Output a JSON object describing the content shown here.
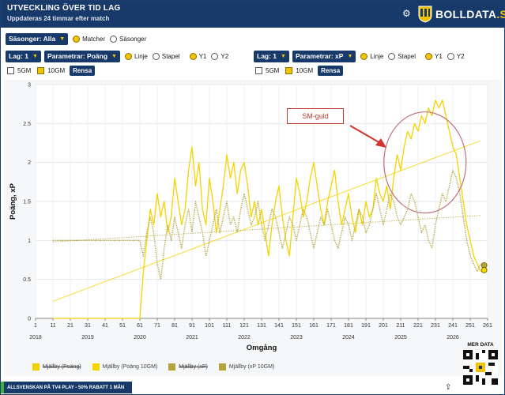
{
  "header": {
    "title": "UTVECKLING ÖVER TID LAG",
    "subtitle": "Uppdateras 24 timmar efter match",
    "logo_text": "BOLLDATA",
    "logo_suffix": ".SE"
  },
  "controls": {
    "seasons_select": "Säsonger: Alla",
    "view_options": [
      "Matcher",
      "Säsonger"
    ],
    "left": {
      "team_select": "Lag: 1",
      "param_select": "Parametrar: Poäng",
      "chart_types": [
        "Linje",
        "Stapel"
      ],
      "axes": [
        "Y1",
        "Y2"
      ],
      "smoothing": [
        "5GM",
        "10GM"
      ],
      "reset_label": "Rensa"
    },
    "right": {
      "team_select": "Lag: 1",
      "param_select": "Parametrar: xP",
      "chart_types": [
        "Linje",
        "Stapel"
      ],
      "axes": [
        "Y1",
        "Y2"
      ],
      "smoothing": [
        "5GM",
        "10GM"
      ],
      "reset_label": "Rensa"
    }
  },
  "annotation": "SM-guld",
  "legend": [
    {
      "label": "Mjällby (Poäng)",
      "color": "#f2d100",
      "enabled": false
    },
    {
      "label": "Mjällby (Poäng 10GM)",
      "color": "#f5d400",
      "enabled": true
    },
    {
      "label": "Mjällby (xP)",
      "color": "#b5a43c",
      "enabled": false
    },
    {
      "label": "Mjällby (xP 10GM)",
      "color": "#b5a43c",
      "enabled": true
    }
  ],
  "footer": {
    "banner": "ALLSVENSKAN PÅ TV4 PLAY - 50% RABATT 1 MÅN",
    "qr_label": "MER DATA"
  },
  "chart_data": {
    "type": "line",
    "xlabel": "Omgång",
    "ylabel": "Poäng, xP",
    "xlim": [
      1,
      261
    ],
    "ylim": [
      0,
      3
    ],
    "x_ticks": [
      1,
      11,
      21,
      31,
      41,
      51,
      61,
      71,
      81,
      91,
      101,
      111,
      121,
      131,
      141,
      151,
      161,
      171,
      181,
      191,
      201,
      211,
      221,
      231,
      241,
      251,
      261
    ],
    "y_ticks": [
      0,
      0.5,
      1,
      1.5,
      2,
      2.5,
      3
    ],
    "season_labels": [
      {
        "label": "2018",
        "x": 1
      },
      {
        "label": "2019",
        "x": 31
      },
      {
        "label": "2020",
        "x": 61
      },
      {
        "label": "2021",
        "x": 91
      },
      {
        "label": "2022",
        "x": 121
      },
      {
        "label": "2023",
        "x": 151
      },
      {
        "label": "2024",
        "x": 181
      },
      {
        "label": "2025",
        "x": 211
      },
      {
        "label": "2026",
        "x": 241
      }
    ],
    "series": [
      {
        "name": "Mjällby (Poäng 10GM)",
        "color": "#f5d400",
        "style": "solid",
        "points": [
          [
            11,
            0
          ],
          [
            61,
            0
          ],
          [
            62,
            0.3
          ],
          [
            63,
            0.6
          ],
          [
            65,
            1.0
          ],
          [
            67,
            1.4
          ],
          [
            69,
            1.2
          ],
          [
            71,
            1.6
          ],
          [
            73,
            1.3
          ],
          [
            75,
            1.5
          ],
          [
            77,
            1.1
          ],
          [
            79,
            1.3
          ],
          [
            81,
            1.8
          ],
          [
            83,
            1.5
          ],
          [
            85,
            1.2
          ],
          [
            87,
            1.4
          ],
          [
            89,
            1.9
          ],
          [
            91,
            2.2
          ],
          [
            93,
            1.7
          ],
          [
            95,
            2.0
          ],
          [
            97,
            1.4
          ],
          [
            99,
            1.2
          ],
          [
            101,
            1.8
          ],
          [
            103,
            1.5
          ],
          [
            105,
            1.1
          ],
          [
            107,
            1.4
          ],
          [
            109,
            1.7
          ],
          [
            111,
            2.1
          ],
          [
            113,
            1.8
          ],
          [
            115,
            2.0
          ],
          [
            117,
            1.6
          ],
          [
            119,
            1.9
          ],
          [
            121,
            2.0
          ],
          [
            123,
            1.7
          ],
          [
            125,
            1.3
          ],
          [
            127,
            1.5
          ],
          [
            129,
            1.2
          ],
          [
            131,
            1.4
          ],
          [
            133,
            1.1
          ],
          [
            135,
            0.8
          ],
          [
            137,
            1.2
          ],
          [
            139,
            1.5
          ],
          [
            141,
            1.7
          ],
          [
            143,
            1.3
          ],
          [
            145,
            1.0
          ],
          [
            147,
            0.8
          ],
          [
            149,
            1.3
          ],
          [
            151,
            1.8
          ],
          [
            153,
            1.6
          ],
          [
            155,
            1.3
          ],
          [
            157,
            1.5
          ],
          [
            159,
            1.8
          ],
          [
            161,
            2.0
          ],
          [
            163,
            1.7
          ],
          [
            165,
            1.4
          ],
          [
            167,
            1.2
          ],
          [
            169,
            1.5
          ],
          [
            171,
            1.7
          ],
          [
            173,
            1.9
          ],
          [
            175,
            1.5
          ],
          [
            177,
            1.2
          ],
          [
            179,
            1.4
          ],
          [
            181,
            1.6
          ],
          [
            183,
            1.3
          ],
          [
            185,
            1.1
          ],
          [
            187,
            1.4
          ],
          [
            189,
            1.2
          ],
          [
            191,
            1.5
          ],
          [
            193,
            1.3
          ],
          [
            195,
            1.4
          ],
          [
            197,
            1.8
          ],
          [
            199,
            1.6
          ],
          [
            201,
            1.5
          ],
          [
            203,
            1.7
          ],
          [
            205,
            1.4
          ],
          [
            207,
            1.8
          ],
          [
            209,
            2.1
          ],
          [
            211,
            1.9
          ],
          [
            213,
            2.2
          ],
          [
            215,
            2.4
          ],
          [
            217,
            2.3
          ],
          [
            219,
            2.5
          ],
          [
            221,
            2.4
          ],
          [
            223,
            2.6
          ],
          [
            225,
            2.5
          ],
          [
            227,
            2.7
          ],
          [
            229,
            2.6
          ],
          [
            231,
            2.8
          ],
          [
            233,
            2.7
          ],
          [
            235,
            2.8
          ],
          [
            237,
            2.6
          ],
          [
            239,
            2.4
          ],
          [
            241,
            2.2
          ],
          [
            243,
            2.1
          ],
          [
            245,
            1.8
          ],
          [
            247,
            1.5
          ],
          [
            249,
            1.2
          ],
          [
            251,
            1.0
          ],
          [
            253,
            0.8
          ],
          [
            255,
            0.7
          ],
          [
            257,
            0.6
          ]
        ]
      },
      {
        "name": "Mjällby (xP 10GM)",
        "color": "#b5a43c",
        "style": "dotted",
        "points": [
          [
            11,
            1.0
          ],
          [
            61,
            1.0
          ],
          [
            63,
            0.8
          ],
          [
            65,
            1.1
          ],
          [
            67,
            1.3
          ],
          [
            69,
            1.1
          ],
          [
            71,
            0.7
          ],
          [
            73,
            0.5
          ],
          [
            75,
            0.9
          ],
          [
            77,
            1.2
          ],
          [
            79,
            1.0
          ],
          [
            81,
            1.3
          ],
          [
            83,
            1.1
          ],
          [
            85,
            0.9
          ],
          [
            87,
            1.2
          ],
          [
            89,
            1.4
          ],
          [
            91,
            1.1
          ],
          [
            93,
            1.5
          ],
          [
            95,
            1.3
          ],
          [
            97,
            1.1
          ],
          [
            99,
            0.8
          ],
          [
            101,
            1.0
          ],
          [
            103,
            1.2
          ],
          [
            105,
            1.4
          ],
          [
            107,
            1.1
          ],
          [
            109,
            1.3
          ],
          [
            111,
            1.5
          ],
          [
            113,
            1.2
          ],
          [
            115,
            1.3
          ],
          [
            117,
            1.1
          ],
          [
            119,
            1.4
          ],
          [
            121,
            1.6
          ],
          [
            123,
            1.4
          ],
          [
            125,
            1.2
          ],
          [
            127,
            1.3
          ],
          [
            129,
            1.5
          ],
          [
            131,
            1.2
          ],
          [
            133,
            1.0
          ],
          [
            135,
            1.2
          ],
          [
            137,
            1.4
          ],
          [
            139,
            1.3
          ],
          [
            141,
            1.1
          ],
          [
            143,
            0.9
          ],
          [
            145,
            1.1
          ],
          [
            147,
            1.3
          ],
          [
            149,
            1.2
          ],
          [
            151,
            1.0
          ],
          [
            153,
            1.2
          ],
          [
            155,
            1.4
          ],
          [
            157,
            1.3
          ],
          [
            159,
            1.1
          ],
          [
            161,
            0.9
          ],
          [
            163,
            1.1
          ],
          [
            165,
            1.3
          ],
          [
            167,
            1.2
          ],
          [
            169,
            1.4
          ],
          [
            171,
            1.2
          ],
          [
            173,
            1.0
          ],
          [
            175,
            0.9
          ],
          [
            177,
            1.1
          ],
          [
            179,
            1.3
          ],
          [
            181,
            1.2
          ],
          [
            183,
            1.0
          ],
          [
            185,
            1.2
          ],
          [
            187,
            1.4
          ],
          [
            189,
            1.3
          ],
          [
            191,
            1.1
          ],
          [
            193,
            1.2
          ],
          [
            195,
            1.4
          ],
          [
            197,
            1.6
          ],
          [
            199,
            1.4
          ],
          [
            201,
            1.2
          ],
          [
            203,
            1.4
          ],
          [
            205,
            1.6
          ],
          [
            207,
            1.5
          ],
          [
            209,
            1.3
          ],
          [
            211,
            1.2
          ],
          [
            213,
            1.3
          ],
          [
            215,
            1.4
          ],
          [
            217,
            1.6
          ],
          [
            219,
            1.5
          ],
          [
            221,
            1.3
          ],
          [
            223,
            1.1
          ],
          [
            225,
            1.2
          ],
          [
            227,
            1.0
          ],
          [
            229,
            0.9
          ],
          [
            231,
            1.2
          ],
          [
            233,
            1.4
          ],
          [
            235,
            1.6
          ],
          [
            237,
            1.5
          ],
          [
            239,
            1.7
          ],
          [
            241,
            1.9
          ],
          [
            243,
            1.8
          ],
          [
            245,
            1.6
          ],
          [
            247,
            1.3
          ],
          [
            249,
            1.0
          ],
          [
            251,
            0.8
          ],
          [
            253,
            0.7
          ],
          [
            255,
            0.6
          ],
          [
            257,
            0.7
          ]
        ]
      }
    ],
    "trendlines": [
      {
        "name": "Poäng trend",
        "color": "#f5d400",
        "from": [
          11,
          0.22
        ],
        "to": [
          257,
          2.28
        ]
      },
      {
        "name": "xP trend",
        "color": "#b5a43c",
        "from": [
          11,
          0.98
        ],
        "to": [
          257,
          1.32
        ]
      }
    ],
    "end_markers": [
      {
        "x": 259,
        "y": 0.68,
        "color": "#b5a43c"
      },
      {
        "x": 259,
        "y": 0.62,
        "color": "#f5d400"
      }
    ]
  }
}
